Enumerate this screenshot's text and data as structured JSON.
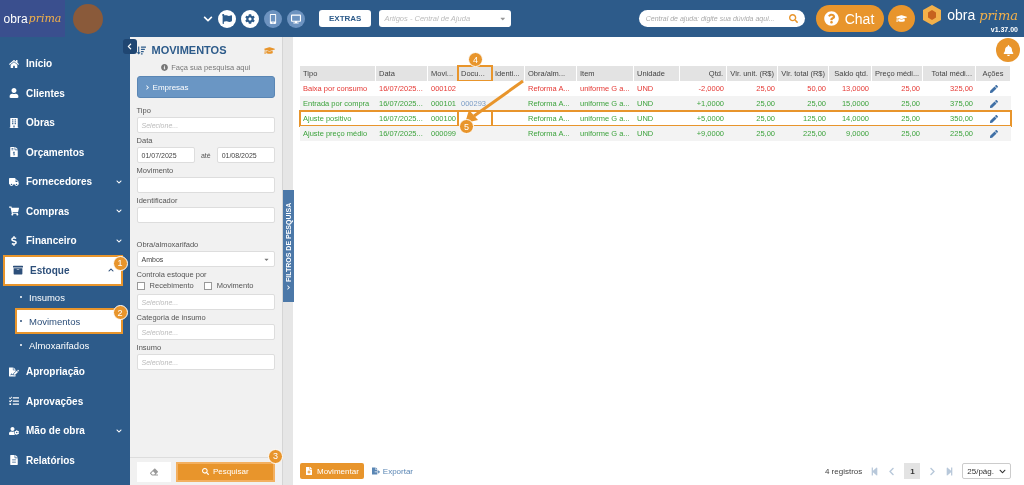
{
  "topbar": {
    "logo": {
      "part_1": "obra",
      "part_2": "prima"
    },
    "extras_button": "EXTRAS",
    "articles_select": {
      "placeholder": "Artigos - Central de Ajuda"
    },
    "help_search": {
      "placeholder": "Central de ajuda: digite sua dúvida aqui..."
    },
    "chat_button": "Chat",
    "brand": {
      "part_1": "obra",
      "part_2": "prima",
      "version": "v1.37.00"
    }
  },
  "sidebar": {
    "items": [
      {
        "label": "Início",
        "has_children": false,
        "selected": false
      },
      {
        "label": "Clientes",
        "has_children": false,
        "selected": false
      },
      {
        "label": "Obras",
        "has_children": false,
        "selected": false
      },
      {
        "label": "Orçamentos",
        "has_children": false,
        "selected": false
      },
      {
        "label": "Fornecedores",
        "has_children": true,
        "expanded": false,
        "selected": false
      },
      {
        "label": "Compras",
        "has_children": true,
        "expanded": false,
        "selected": false
      },
      {
        "label": "Financeiro",
        "has_children": true,
        "expanded": false,
        "selected": false
      },
      {
        "label": "Estoque",
        "has_children": true,
        "expanded": true,
        "selected": true,
        "callout": "1",
        "children": [
          {
            "label": "Insumos",
            "selected": false
          },
          {
            "label": "Movimentos",
            "selected": true,
            "callout": "2"
          },
          {
            "label": "Almoxarifados",
            "selected": false
          }
        ]
      },
      {
        "label": "Apropriação",
        "has_children": false,
        "selected": false
      },
      {
        "label": "Aprovações",
        "has_children": false,
        "selected": false
      },
      {
        "label": "Mão de obra",
        "has_children": true,
        "expanded": false,
        "selected": false
      },
      {
        "label": "Relatórios",
        "has_children": false,
        "selected": false
      }
    ]
  },
  "filters": {
    "title": "MOVIMENTOS",
    "hint": "Faça sua pesquisa aqui",
    "section": "Empresas",
    "tipo": {
      "label": "Tipo",
      "placeholder": "Selecione..."
    },
    "data": {
      "label": "Data",
      "from": "01/07/2025",
      "separator": "até",
      "to": "01/08/2025"
    },
    "movimento": {
      "label": "Movimento"
    },
    "identificador": {
      "label": "Identificador"
    },
    "obra": {
      "label": "Obra/almoxarifado",
      "value": "Ambos"
    },
    "controla": {
      "label": "Controla estoque por",
      "options": [
        {
          "label": "Recebimento",
          "checked": false
        },
        {
          "label": "Movimento",
          "checked": false
        }
      ],
      "placeholder": "Selecione..."
    },
    "categoria": {
      "label": "Categoria de insumo",
      "placeholder": "Selecione..."
    },
    "insumo": {
      "label": "Insumo",
      "placeholder": "Selecione..."
    },
    "search_button": "Pesquisar",
    "search_callout": "3",
    "side_tab": "FILTROS DE PESQUISA"
  },
  "table": {
    "columns": [
      {
        "label": "Tipo"
      },
      {
        "label": "Data"
      },
      {
        "label": "Movi..."
      },
      {
        "label": "Docu...",
        "callout": "4"
      },
      {
        "label": "Identi..."
      },
      {
        "label": "Obra/alm..."
      },
      {
        "label": "Item"
      },
      {
        "label": "Unidade"
      },
      {
        "label": "Qtd."
      },
      {
        "label": "Vlr. unit. (R$)"
      },
      {
        "label": "Vlr. total (R$)"
      },
      {
        "label": "Saldo qtd."
      },
      {
        "label": "Preço médi..."
      },
      {
        "label": "Total médi..."
      },
      {
        "label": "Ações"
      }
    ],
    "rows": [
      {
        "kind": "out",
        "highlighted": false,
        "cells": [
          "Baixa por consumo",
          "16/07/2025...",
          "000102",
          null,
          null,
          "Reforma A...",
          "uniforme G a...",
          "UND",
          "-2,0000",
          "25,00",
          "50,00",
          "13,0000",
          "25,00",
          "325,00"
        ]
      },
      {
        "kind": "in",
        "highlighted": false,
        "cells": [
          "Entrada por compra",
          "16/07/2025...",
          "000101",
          "000293",
          null,
          "Reforma A...",
          "uniforme G a...",
          "UND",
          "+1,0000",
          "25,00",
          "25,00",
          "15,0000",
          "25,00",
          "375,00"
        ]
      },
      {
        "kind": "in",
        "highlighted": true,
        "callout": "5",
        "cells": [
          "Ajuste positivo",
          "16/07/2025...",
          "000100",
          null,
          null,
          "Reforma A...",
          "uniforme G a...",
          "UND",
          "+5,0000",
          "25,00",
          "125,00",
          "14,0000",
          "25,00",
          "350,00"
        ]
      },
      {
        "kind": "in",
        "highlighted": false,
        "cells": [
          "Ajuste preço médio",
          "16/07/2025...",
          "000099",
          null,
          null,
          "Reforma A...",
          "uniforme G a...",
          "UND",
          "+9,0000",
          "25,00",
          "225,00",
          "9,0000",
          "25,00",
          "225,00"
        ]
      }
    ]
  },
  "footer": {
    "primary_button": "Movimentar",
    "export_link": "Exportar",
    "count": "4 registros",
    "pages": [
      {
        "label": "1",
        "selected": true
      }
    ],
    "page_size": "25/pág."
  }
}
